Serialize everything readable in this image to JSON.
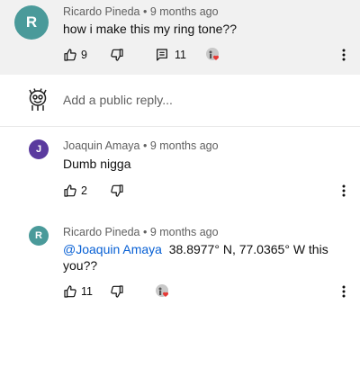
{
  "comments": [
    {
      "author": "Ricardo Pineda",
      "age": "9 months ago",
      "avatar_letter": "R",
      "avatar_color": "#4a9a9a",
      "text": "how i make this my ring tone??",
      "likes": "9",
      "replies": "11",
      "icons": [
        "thumb-up-icon",
        "thumb-down-icon",
        "comment-icon",
        "creator-heart-icon",
        "more-vert-icon"
      ]
    },
    {
      "author": "Joaquin Amaya",
      "age": "9 months ago",
      "avatar_letter": "J",
      "avatar_color": "#5a3a9e",
      "text": "Dumb nigga",
      "likes": "2",
      "icons": [
        "thumb-up-icon",
        "thumb-down-icon",
        "more-vert-icon"
      ]
    },
    {
      "author": "Ricardo Pineda",
      "age": "9 months ago",
      "avatar_letter": "R",
      "avatar_color": "#4a9a9a",
      "mention": "@Joaquin Amaya",
      "text_line1": "38.8977° N, 77.0365° W this",
      "text_line2": "you??",
      "likes": "11",
      "icons": [
        "thumb-up-icon",
        "thumb-down-icon",
        "creator-heart-icon",
        "more-vert-icon"
      ]
    }
  ],
  "reply_box": {
    "placeholder": "Add a public reply...",
    "avatar_icon": "cartoon-avatar-icon"
  },
  "separator": "•"
}
